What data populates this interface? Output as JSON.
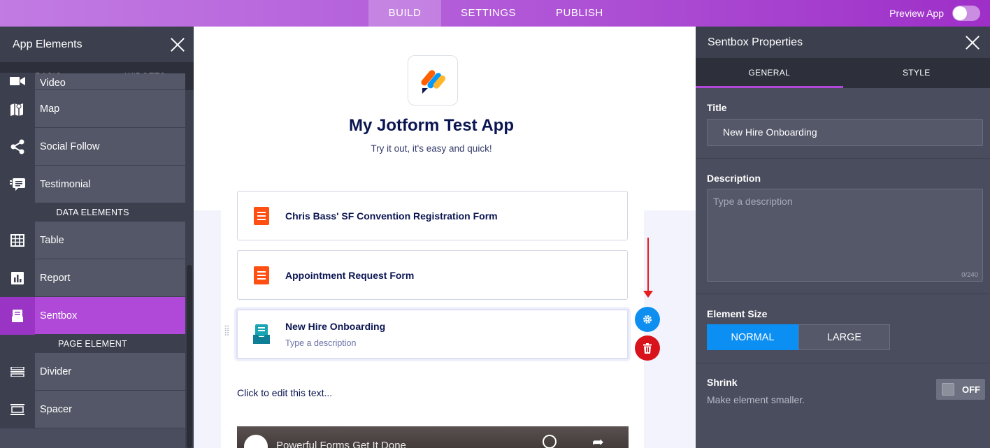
{
  "topbar": {
    "tabs": [
      {
        "label": "BUILD",
        "active": true
      },
      {
        "label": "SETTINGS",
        "active": false
      },
      {
        "label": "PUBLISH",
        "active": false
      }
    ],
    "preview_label": "Preview App",
    "preview_enabled": false
  },
  "left_panel": {
    "title": "App Elements",
    "tabs": [
      {
        "label": "BASIC",
        "active": true
      },
      {
        "label": "WIDGETS",
        "active": false
      }
    ],
    "items": [
      {
        "label": "Video",
        "icon": "video-icon"
      },
      {
        "label": "Map",
        "icon": "map-icon"
      },
      {
        "label": "Social Follow",
        "icon": "share-icon"
      },
      {
        "label": "Testimonial",
        "icon": "testimonial-icon"
      }
    ],
    "data_section": "DATA ELEMENTS",
    "data_items": [
      {
        "label": "Table",
        "icon": "table-icon"
      },
      {
        "label": "Report",
        "icon": "report-icon"
      },
      {
        "label": "Sentbox",
        "icon": "sentbox-icon",
        "selected": true
      }
    ],
    "page_section": "PAGE ELEMENT",
    "page_items": [
      {
        "label": "Divider",
        "icon": "divider-icon"
      },
      {
        "label": "Spacer",
        "icon": "spacer-icon"
      }
    ]
  },
  "canvas": {
    "app_title": "My Jotform Test App",
    "app_subtitle": "Try it out, it's easy and quick!",
    "cards": [
      {
        "name": "Chris Bass' SF Convention Registration Form",
        "icon": "form-icon",
        "description": ""
      },
      {
        "name": "Appointment Request Form",
        "icon": "form-icon",
        "description": ""
      },
      {
        "name": "New Hire Onboarding",
        "icon": "sentbox-icon",
        "description": "Type a description",
        "active": true
      }
    ],
    "edit_text": "Click to edit this text...",
    "video_title": "Powerful Forms Get It Done"
  },
  "right_panel": {
    "title": "Sentbox Properties",
    "tabs": [
      {
        "label": "GENERAL",
        "active": true
      },
      {
        "label": "STYLE",
        "active": false
      }
    ],
    "title_label": "Title",
    "title_value": "New Hire Onboarding",
    "description_label": "Description",
    "description_placeholder": "Type a description",
    "description_counter": "0/240",
    "size_label": "Element Size",
    "size_options": [
      {
        "label": "NORMAL",
        "selected": true
      },
      {
        "label": "LARGE",
        "selected": false
      }
    ],
    "shrink_label": "Shrink",
    "shrink_description": "Make element smaller.",
    "shrink_toggle": "OFF"
  },
  "colors": {
    "accent_purple": "#b049d8",
    "selected_blue": "#0b8ff3",
    "delete_red": "#d8131b",
    "form_orange": "#ff6100",
    "sentbox_teal": "#18a4b3",
    "navy_text": "#0a1551"
  }
}
